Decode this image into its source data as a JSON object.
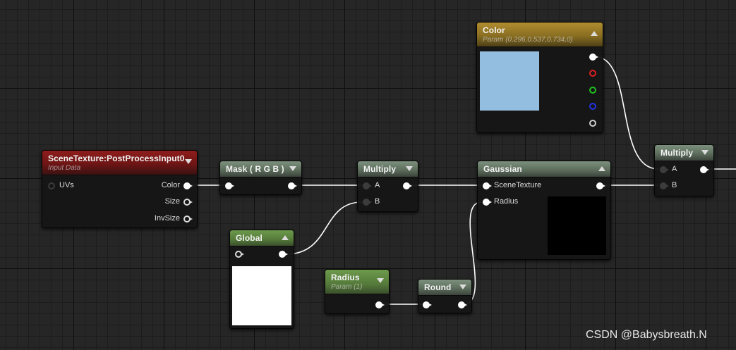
{
  "colors": {
    "canvas": "#262626",
    "wire": "#ffffff",
    "color_swatch": "#94bedf",
    "global_preview": "#ffffff",
    "gaussian_preview": "#000000"
  },
  "nodes": {
    "scene_texture": {
      "title": "SceneTexture:PostProcessInput0",
      "subtitle": "Input Data",
      "inputs": [
        "UVs"
      ],
      "outputs": [
        "Color",
        "Size",
        "InvSize"
      ]
    },
    "mask": {
      "title": "Mask ( R G B )"
    },
    "multiply_1": {
      "title": "Multiply",
      "inputs": [
        "A",
        "B"
      ]
    },
    "global": {
      "title": "Global"
    },
    "gaussian": {
      "title": "Gaussian",
      "inputs": [
        "SceneTexture",
        "Radius"
      ]
    },
    "color": {
      "title": "Color",
      "subtitle": "Param (0.296,0.537,0.734,0)"
    },
    "radius": {
      "title": "Radius",
      "subtitle": "Param (1)"
    },
    "round": {
      "title": "Round"
    },
    "multiply_2": {
      "title": "Multiply",
      "inputs": [
        "A",
        "B"
      ]
    }
  },
  "watermark": "CSDN @Babysbreath.N"
}
